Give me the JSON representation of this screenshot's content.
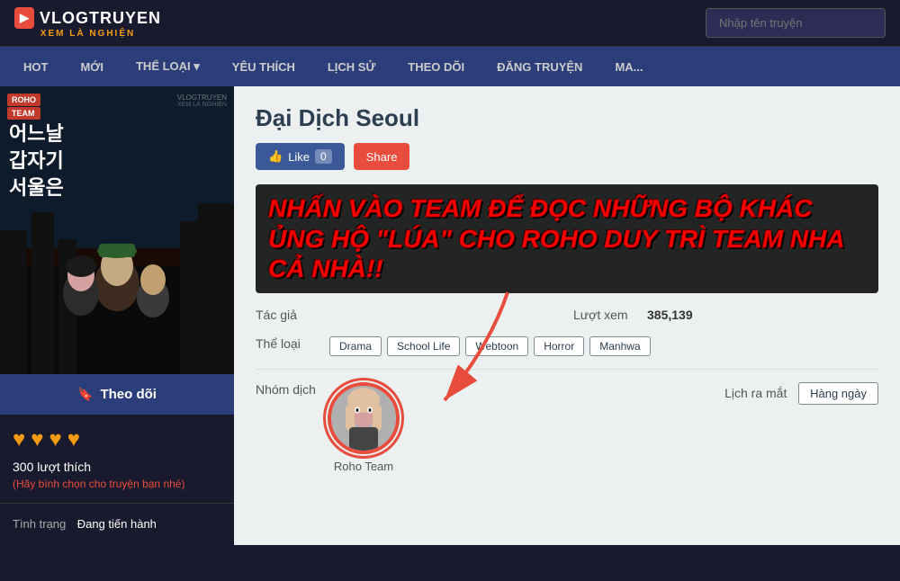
{
  "header": {
    "logo_top": "VLOGTRUYEN",
    "logo_sub": "XEM LÀ NGHIỆN",
    "search_placeholder": "Nhập tên truyện"
  },
  "nav": {
    "items": [
      {
        "label": "HOT",
        "id": "hot"
      },
      {
        "label": "MỚI",
        "id": "moi"
      },
      {
        "label": "THỂ LOẠI ▾",
        "id": "the-loai"
      },
      {
        "label": "YÊU THÍCH",
        "id": "yeu-thich"
      },
      {
        "label": "LỊCH SỬ",
        "id": "lich-su"
      },
      {
        "label": "THEO DÕI",
        "id": "theo-doi"
      },
      {
        "label": "ĐĂNG TRUYỆN",
        "id": "dang-truyen"
      },
      {
        "label": "MA...",
        "id": "more"
      }
    ]
  },
  "manga": {
    "title": "Đại Dịch Seoul",
    "like_count": "0",
    "like_label": "Like",
    "share_label": "Share",
    "promo_text": "NHẤN VÀO TEAM ĐỂ ĐỌC NHỮNG BỘ KHÁC ỦNG HỘ \"LÚA\" CHO ROHO DUY TRÌ TEAM NHA CẢ NHÀ!!",
    "cover_korean_line1": "어느날",
    "cover_korean_line2": "갑자기",
    "cover_korean_line3": "서울은",
    "roho_label": "ROHO",
    "team_label": "TEAM",
    "watermark_top": "VLOGTRUYEN",
    "watermark_bot": "XEM LÀ NGHIỆN",
    "author_label": "Tác giả",
    "author_value": "",
    "views_label": "Lượt xem",
    "views_value": "385,139",
    "genre_label": "Thể loại",
    "genres": [
      "Drama",
      "School Life",
      "Webtoon",
      "Horror",
      "Manhwa"
    ],
    "translator_label": "Nhóm dịch",
    "translator_name": "Roho Team",
    "schedule_label": "Lịch ra mắt",
    "schedule_value": "Hàng ngày",
    "follow_label": "Theo dõi",
    "hearts": [
      "♥",
      "♥",
      "♥",
      "♥"
    ],
    "likes_count": "300 lượt thích",
    "vote_prompt": "(Hãy bình chọn cho truyện bạn nhé)",
    "status_label": "Tình trạng",
    "status_value": "Đang tiến hành"
  }
}
